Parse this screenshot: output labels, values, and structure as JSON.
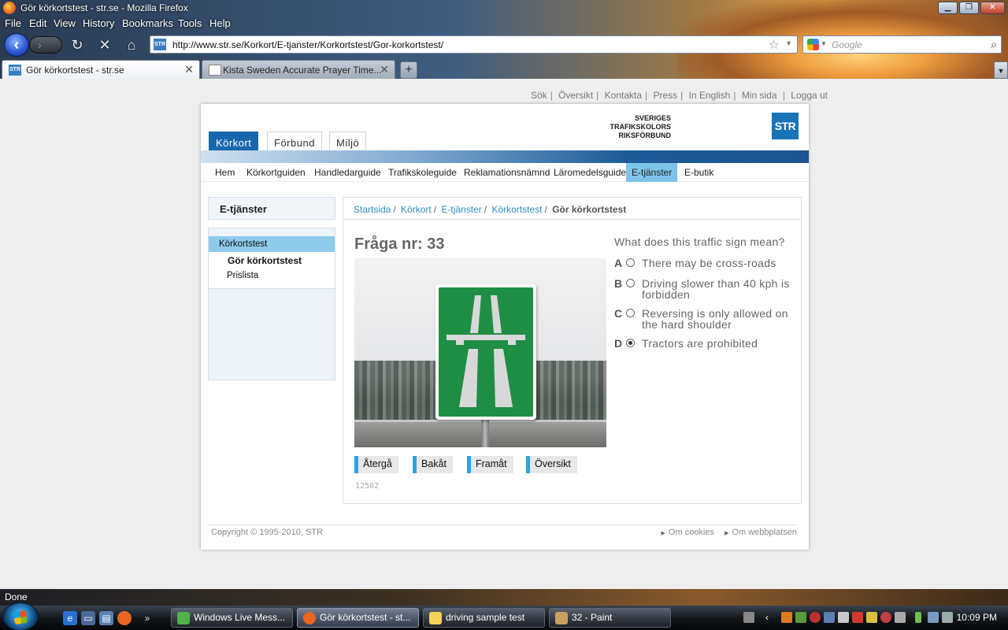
{
  "window": {
    "title": "Gör körkortstest - str.se - Mozilla Firefox",
    "menu": [
      "File",
      "Edit",
      "View",
      "History",
      "Bookmarks",
      "Tools",
      "Help"
    ],
    "url": "http://www.str.se/Korkort/E-tjanster/Korkortstest/Gor-korkortstest/",
    "search_placeholder": "Google",
    "tabs": [
      {
        "title": "Gör körkortstest - str.se",
        "active": true
      },
      {
        "title": "Kista Sweden Accurate Prayer Time...",
        "active": false
      }
    ],
    "status": "Done"
  },
  "site": {
    "top_links": [
      "Sök",
      "Översikt",
      "Kontakta",
      "Press",
      "In English",
      "Min sida",
      "Logga ut"
    ],
    "logo": {
      "line1": "SVERIGES",
      "line2": "TRAFIKSKOLORS",
      "line3": "RIKSFÖRBUND",
      "mark": "STR",
      "brand_color": "#1973b8"
    },
    "main_tabs": [
      "Körkort",
      "Förbund",
      "Miljö"
    ],
    "sub_nav": [
      "Hem",
      "Körkortguiden",
      "Handledarguide",
      "Trafikskoleguide",
      "Reklamationsnämnd",
      "Läromedelsguide",
      "E-tjänster",
      "E-butik"
    ],
    "sidebar": {
      "heading": "E-tjänster",
      "section": "Körkortstest",
      "items": [
        "Gör körkortstest",
        "Prislista"
      ]
    },
    "breadcrumb": [
      "Startsida",
      "Körkort",
      "E-tjänster",
      "Körkortstest"
    ],
    "breadcrumb_current": "Gör körkortstest",
    "quiz": {
      "title": "Fråga nr: 33",
      "question": "What does this traffic sign mean?",
      "options": [
        {
          "letter": "A",
          "text": "There may be cross-roads",
          "selected": false
        },
        {
          "letter": "B",
          "text": "Driving slower than 40 kph is forbidden",
          "selected": false
        },
        {
          "letter": "C",
          "text": "Reversing is only allowed on the hard shoulder",
          "selected": false
        },
        {
          "letter": "D",
          "text": "Tractors are prohibited",
          "selected": true
        }
      ],
      "buttons": [
        "Återgå",
        "Bakåt",
        "Framåt",
        "Översikt"
      ],
      "id_text": "12502"
    },
    "footer": {
      "copyright": "Copyright © 1995-2010, STR",
      "links": [
        "Om cookies",
        "Om webbplatsen"
      ]
    }
  },
  "taskbar": {
    "items": [
      "Windows Live Mess...",
      "Gör körkortstest - st...",
      "driving sample test",
      "32 - Paint"
    ],
    "clock": "10:09 PM"
  }
}
